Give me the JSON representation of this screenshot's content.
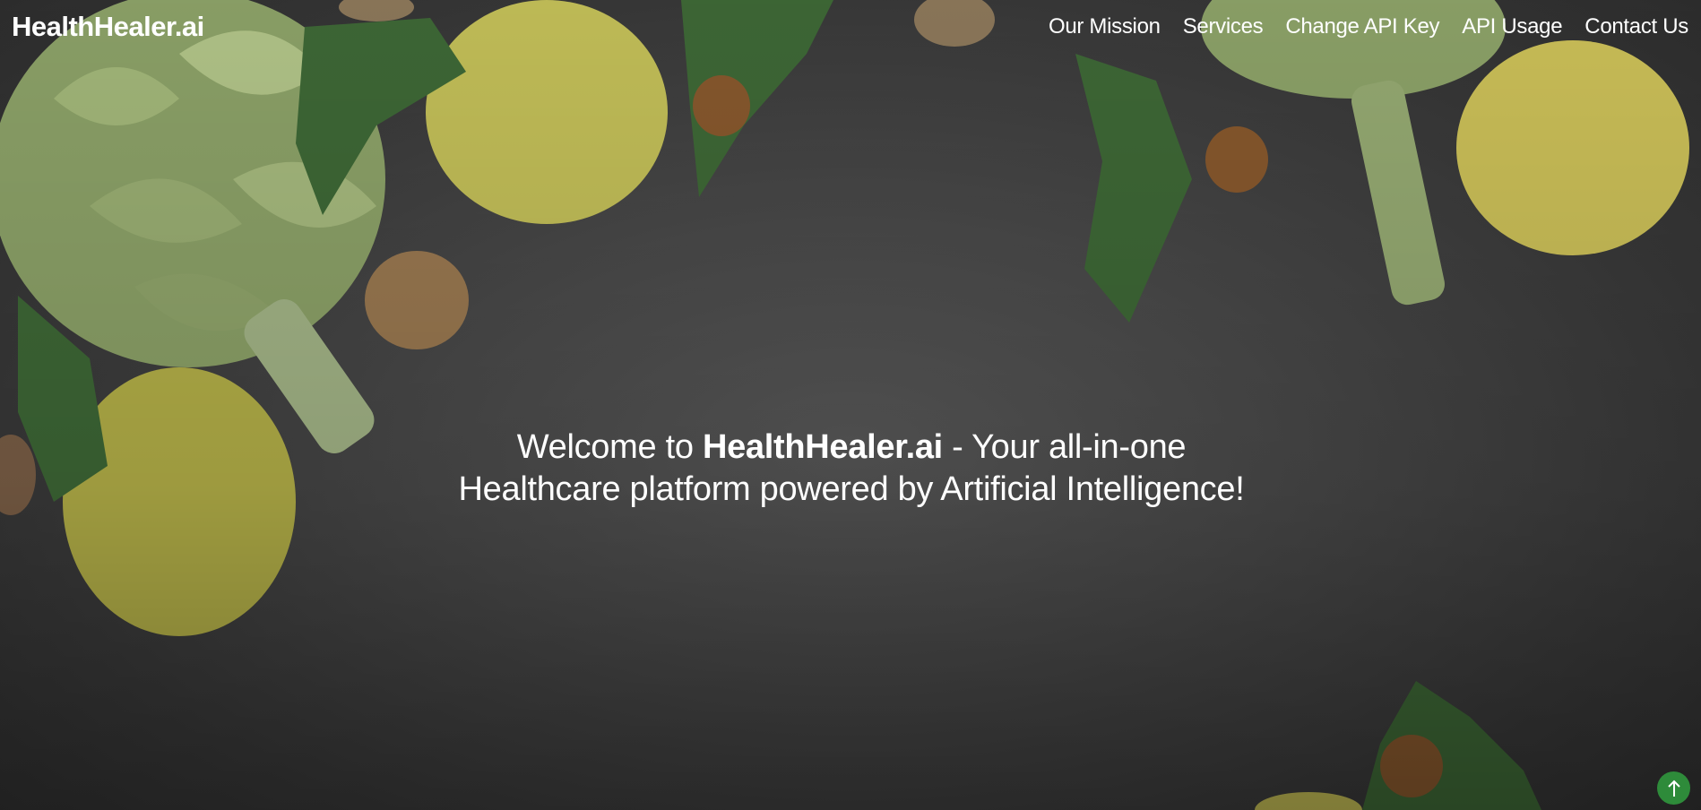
{
  "brand": {
    "name": "HealthHealer.ai"
  },
  "nav": {
    "items": [
      {
        "label": "Our Mission"
      },
      {
        "label": "Services"
      },
      {
        "label": "Change API Key"
      },
      {
        "label": "API Usage"
      },
      {
        "label": "Contact Us"
      }
    ]
  },
  "hero": {
    "prefix": "Welcome to ",
    "brand": "HealthHealer.ai",
    "suffix": " - Your all-in-one Healthcare platform powered by Artificial Intelligence!"
  },
  "back_to_top": {
    "icon": "arrow-up-icon"
  },
  "colors": {
    "accent": "#2e8b3a",
    "text": "#ffffff",
    "background": "#4b4b4b"
  }
}
